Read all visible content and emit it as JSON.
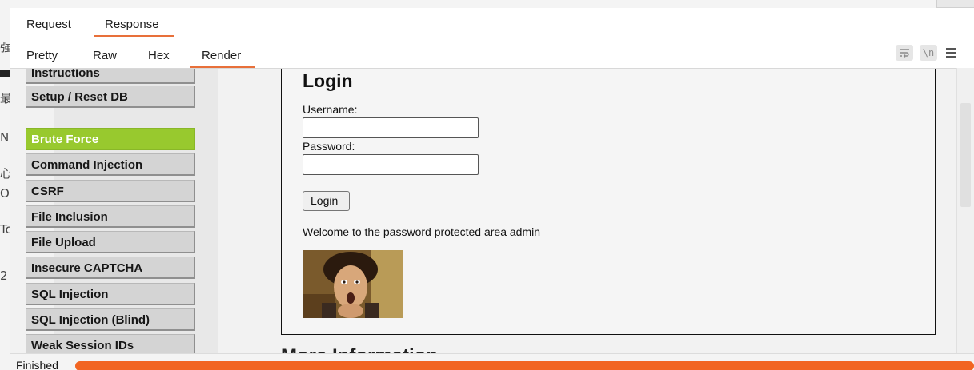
{
  "background_window": {
    "chars": [
      "强",
      "最",
      "N",
      "心",
      "O",
      "To",
      "2"
    ]
  },
  "message_tabs": [
    {
      "label": "Request",
      "selected": false
    },
    {
      "label": "Response",
      "selected": true
    }
  ],
  "view_tabs": [
    {
      "label": "Pretty",
      "selected": false
    },
    {
      "label": "Raw",
      "selected": false
    },
    {
      "label": "Hex",
      "selected": false
    },
    {
      "label": "Render",
      "selected": true
    }
  ],
  "toolbar": {
    "wrap_icon": "wrap-lines-icon",
    "newline_label": "\\n",
    "menu_icon": "hamburger-menu-icon"
  },
  "rendered_page": {
    "nav_top": [
      "Instructions",
      "Setup / Reset DB"
    ],
    "nav_vulns": [
      {
        "label": "Brute Force",
        "active": true
      },
      {
        "label": "Command Injection",
        "active": false
      },
      {
        "label": "CSRF",
        "active": false
      },
      {
        "label": "File Inclusion",
        "active": false
      },
      {
        "label": "File Upload",
        "active": false
      },
      {
        "label": "Insecure CAPTCHA",
        "active": false
      },
      {
        "label": "SQL Injection",
        "active": false
      },
      {
        "label": "SQL Injection (Blind)",
        "active": false
      },
      {
        "label": "Weak Session IDs",
        "active": false
      }
    ],
    "form": {
      "title": "Login",
      "username_label": "Username:",
      "username_value": "",
      "password_label": "Password:",
      "password_value": "",
      "submit_label": "Login",
      "welcome_text": "Welcome to the password protected area admin"
    },
    "next_heading": "More Information"
  },
  "status": {
    "text": "Finished",
    "progress_percent": 100,
    "progress_color": "#f26522"
  },
  "colors": {
    "accent": "#e8703a",
    "nav_active": "#98c92e"
  }
}
